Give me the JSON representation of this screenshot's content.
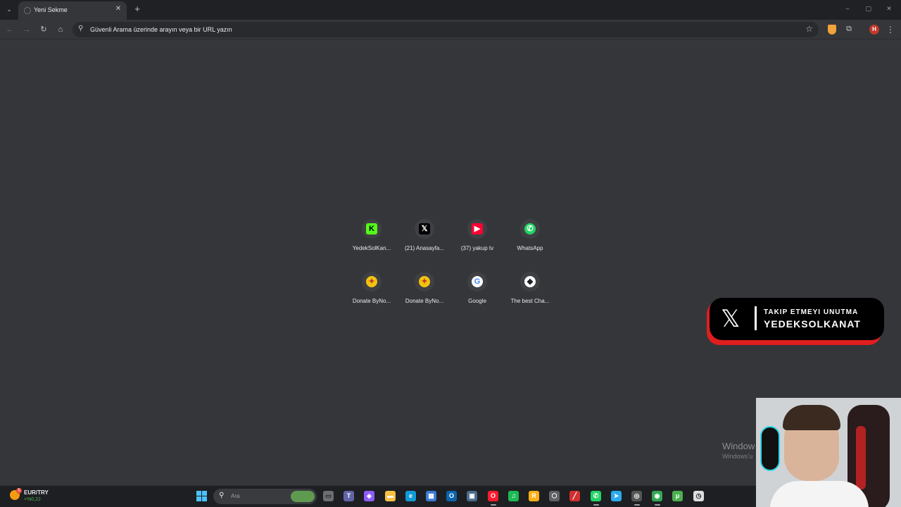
{
  "browser": {
    "tab_title": "Yeni Sekme",
    "omnibox_placeholder": "Güvenli Arama üzerinde arayın veya bir URL yazın",
    "profile_initial": "H"
  },
  "shortcuts": [
    {
      "label": "YedekSolKan...",
      "icon": "kick-icon",
      "color": "#53fc18",
      "glyph": "K"
    },
    {
      "label": "(21) Anasayfa...",
      "icon": "x-twitter-icon",
      "color": "#000000",
      "glyph": "𝕏"
    },
    {
      "label": "(37) yakup tv",
      "icon": "youtube-icon",
      "color": "#ff0033",
      "glyph": "▶"
    },
    {
      "label": "WhatsApp",
      "icon": "whatsapp-icon",
      "color": "#25d366",
      "glyph": "✆"
    },
    {
      "label": "Donate ByNo...",
      "icon": "donate-icon",
      "color": "#f1c40f",
      "glyph": "✦"
    },
    {
      "label": "Donate ByNo...",
      "icon": "donate-icon",
      "color": "#f1c40f",
      "glyph": "✦"
    },
    {
      "label": "Google",
      "icon": "google-icon",
      "color": "#ffffff",
      "glyph": "G"
    },
    {
      "label": "The best Cha...",
      "icon": "chat-icon",
      "color": "#ffffff",
      "glyph": "◆"
    }
  ],
  "banner": {
    "line1": "TAKIP ETMEYI UNUTMA",
    "line2": "YEDEKSOLKANAT"
  },
  "watermark": {
    "line1": "Window",
    "line2": "Windows'u"
  },
  "taskbar": {
    "currency_label": "EUR/TRY",
    "currency_change": "+%0,22",
    "weather_badge": "5",
    "search_placeholder": "Ara",
    "apps": [
      {
        "name": "task-view-icon",
        "color": "#6b6e73",
        "glyph": "▭"
      },
      {
        "name": "teams-icon",
        "color": "#6264a7",
        "glyph": "T"
      },
      {
        "name": "copilot-icon",
        "color": "#8e5cf7",
        "glyph": "◈"
      },
      {
        "name": "file-explorer-icon",
        "color": "#f6c243",
        "glyph": "▬"
      },
      {
        "name": "edge-icon",
        "color": "#0f9bd7",
        "glyph": "e"
      },
      {
        "name": "store-icon",
        "color": "#3a7bd5",
        "glyph": "▦"
      },
      {
        "name": "outlook-icon",
        "color": "#0a64ad",
        "glyph": "O"
      },
      {
        "name": "app-window-icon",
        "color": "#4a6b8a",
        "glyph": "▣"
      },
      {
        "name": "opera-icon",
        "color": "#ff1b2d",
        "glyph": "O"
      },
      {
        "name": "spotify-icon",
        "color": "#1db954",
        "glyph": "♫"
      },
      {
        "name": "rockstar-icon",
        "color": "#fcaf17",
        "glyph": "R"
      },
      {
        "name": "settings-app-icon",
        "color": "#5f6368",
        "glyph": "⬡"
      },
      {
        "name": "streamlabs-icon",
        "color": "#d32f2f",
        "glyph": "╱"
      },
      {
        "name": "whatsapp-icon",
        "color": "#25d366",
        "glyph": "✆"
      },
      {
        "name": "telegram-icon",
        "color": "#2aabee",
        "glyph": "➤"
      },
      {
        "name": "obs-icon",
        "color": "#555555",
        "glyph": "◎"
      },
      {
        "name": "chrome-icon",
        "color": "#34a853",
        "glyph": "◉"
      },
      {
        "name": "utorrent-icon",
        "color": "#4caf50",
        "glyph": "μ"
      },
      {
        "name": "timer-app-icon",
        "color": "#dddddd",
        "glyph": "◷"
      }
    ]
  }
}
